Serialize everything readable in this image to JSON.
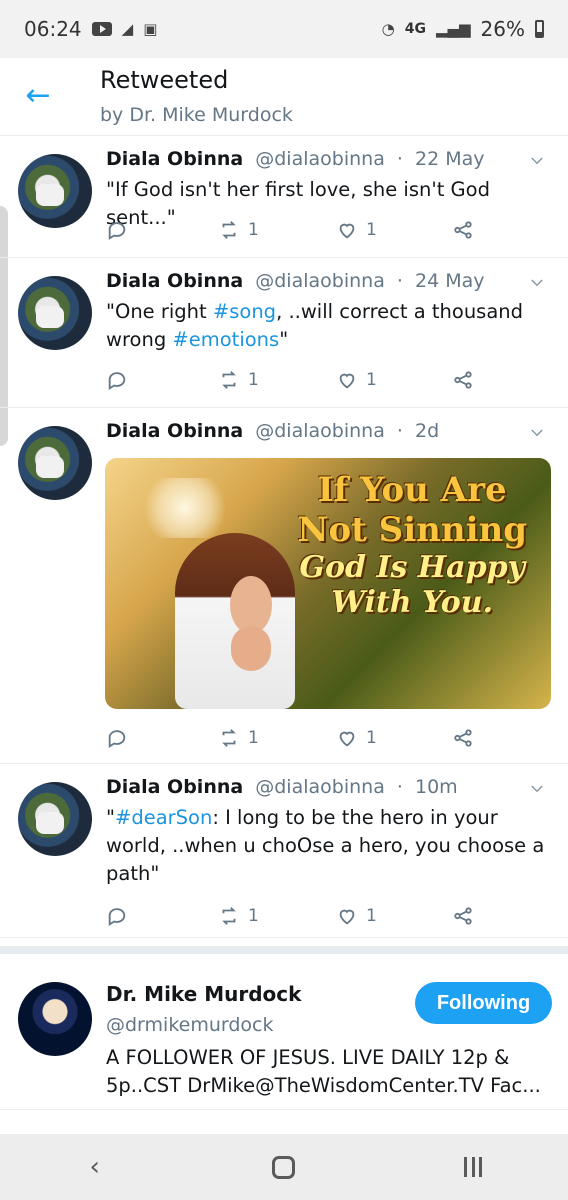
{
  "status": {
    "time": "06:24",
    "network": "4G",
    "battery": "26%"
  },
  "header": {
    "title": "Retweeted",
    "subtitle": "by Dr. Mike Murdock"
  },
  "tweets": [
    {
      "name": "Diala Obinna",
      "handle": "@dialaobinna",
      "date": "22 May",
      "text_parts": [
        "\"If God isn't her first love, she isn't God sent...\""
      ],
      "retweets": "1",
      "likes": "1"
    },
    {
      "name": "Diala Obinna",
      "handle": "@dialaobinna",
      "date": "24 May",
      "text_parts": [
        "\"One right ",
        "#song",
        ", ..will correct a thousand wrong ",
        "#emotions",
        "\""
      ],
      "retweets": "1",
      "likes": "1"
    },
    {
      "name": "Diala Obinna",
      "handle": "@dialaobinna",
      "date": "2d",
      "image_text": [
        "If You Are",
        "Not Sinning",
        "God Is Happy",
        "With You."
      ],
      "retweets": "1",
      "likes": "1"
    },
    {
      "name": "Diala Obinna",
      "handle": "@dialaobinna",
      "date": "10m",
      "text_parts": [
        "\"",
        "#dearSon",
        ": I long to be the hero in your world,   ..when u choOse a hero, you choose a path\""
      ],
      "retweets": "1",
      "likes": "1"
    }
  ],
  "profile": {
    "name": "Dr. Mike Murdock",
    "handle": "@drmikemurdock",
    "bio": "A FOLLOWER OF JESUS. LIVE DAILY 12p & 5p..CST DrMike@TheWisdomCenter.TV Fac...",
    "follow_label": "Following"
  },
  "icons": {
    "back": "back-arrow-icon",
    "reply": "reply-icon",
    "retweet": "retweet-icon",
    "like": "heart-icon",
    "share": "share-icon",
    "chevron": "chevron-down-icon"
  },
  "colors": {
    "brand_blue": "#1da1f2",
    "link_blue": "#1b95e0",
    "muted": "#657786",
    "border": "#e6ecf0"
  }
}
